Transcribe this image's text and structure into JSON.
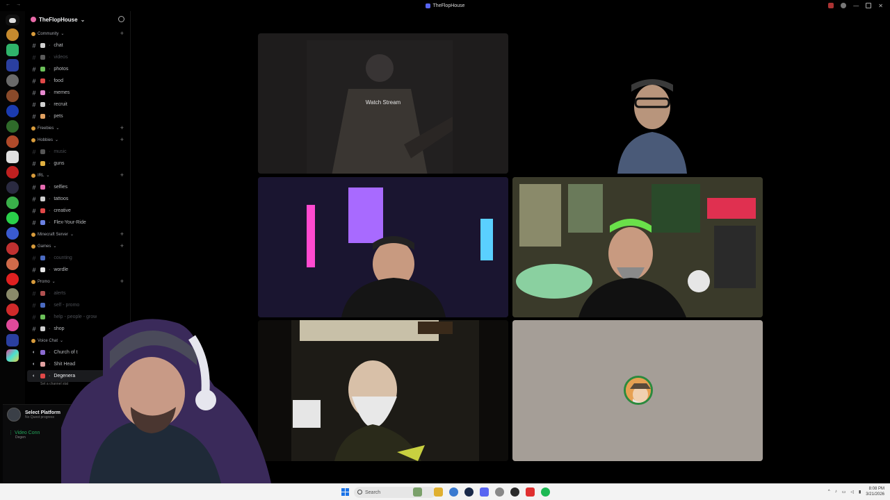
{
  "window": {
    "title": "TheFlopHouse"
  },
  "sidebar": {
    "server_name": "TheFlopHouse",
    "categories": [
      {
        "label": "Community",
        "channels": [
          {
            "label": "chat",
            "emoji_color": "#cfcfcf",
            "muted": false
          },
          {
            "label": "videos",
            "emoji_color": "#5a5a5a",
            "muted": true
          },
          {
            "label": "photos",
            "emoji_color": "#6bbf59",
            "muted": false
          },
          {
            "label": "food",
            "emoji_color": "#e04848",
            "muted": false
          },
          {
            "label": "memes",
            "emoji_color": "#e78ad0",
            "muted": false
          },
          {
            "label": "recruit",
            "emoji_color": "#cfcfcf",
            "muted": false
          },
          {
            "label": "pets",
            "emoji_color": "#e0a060",
            "muted": false
          }
        ]
      },
      {
        "label": "Freebies",
        "channels": []
      },
      {
        "label": "Hobbies",
        "channels": [
          {
            "label": "music",
            "emoji_color": "#555555",
            "muted": true
          },
          {
            "label": "guns",
            "emoji_color": "#e0b040",
            "muted": false
          }
        ]
      },
      {
        "label": "IRL",
        "channels": [
          {
            "label": "selfies",
            "emoji_color": "#e46ab0",
            "muted": false
          },
          {
            "label": "tattoos",
            "emoji_color": "#cfcfcf",
            "muted": false
          },
          {
            "label": "creative",
            "emoji_color": "#e04848",
            "muted": false
          },
          {
            "label": "Flex-Your-Ride",
            "emoji_color": "#6a80e0",
            "muted": false
          }
        ]
      },
      {
        "label": "Minecraft Server",
        "channels": []
      },
      {
        "label": "Games",
        "channels": [
          {
            "label": "counting",
            "emoji_color": "#4a6ac0",
            "muted": true
          },
          {
            "label": "wordle",
            "emoji_color": "#e6e6e6",
            "muted": false
          }
        ]
      },
      {
        "label": "Promo",
        "channels": [
          {
            "label": "alerts",
            "emoji_color": "#b05050",
            "muted": true
          },
          {
            "label": "self - promo",
            "emoji_color": "#4a6ac0",
            "muted": true
          },
          {
            "label": "help - people - grow",
            "emoji_color": "#6bbf59",
            "muted": true
          },
          {
            "label": "shop",
            "emoji_color": "#cfcfcf",
            "muted": false
          }
        ]
      },
      {
        "label": "Voice Chat",
        "channels": [
          {
            "label": "Church of t",
            "emoji_color": "#8a6ad0",
            "muted": false,
            "voice": true
          },
          {
            "label": "Shit Head",
            "emoji_color": "#e0a0a0",
            "muted": false,
            "voice": true
          },
          {
            "label": "Degenera",
            "emoji_color": "#e04848",
            "muted": false,
            "voice": true,
            "active": true
          }
        ]
      }
    ],
    "voice_status": "Set a channel stat",
    "user_panel": {
      "platform_label": "Select Platform",
      "quest_text": "No Quest progress",
      "video_label": "Video Conn",
      "video_sub": "Degen"
    }
  },
  "stage": {
    "stream_label": "Watch Stream"
  },
  "taskbar": {
    "search_placeholder": "Search",
    "time": "8:08 PM",
    "date": "3/21/2026"
  },
  "colors": {
    "accent": "#5865f2",
    "voice_connected": "#23a55a",
    "background": "#000000"
  }
}
